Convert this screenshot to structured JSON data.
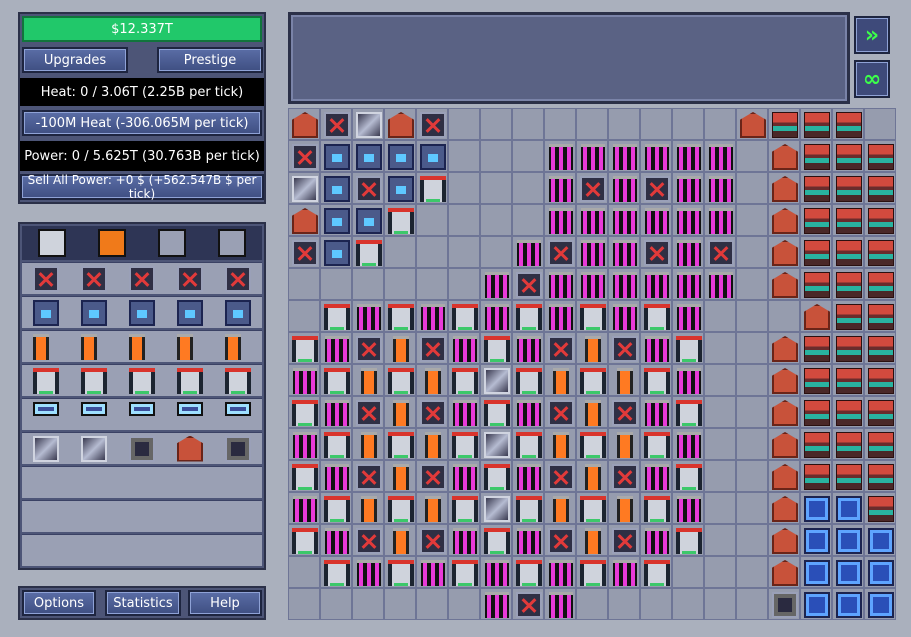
{
  "money": "$12.337T",
  "buttons": {
    "upgrades": "Upgrades",
    "prestige": "Prestige",
    "vent_heat": "-100M Heat (-306.065M per tick)",
    "sell_power": "Sell All Power: +0 $ (+562.547B $ per tick)",
    "options": "Options",
    "statistics": "Statistics",
    "help": "Help"
  },
  "heat_status": "Heat: 0 / 3.06T (2.25B per tick)",
  "power_status": "Power: 0 / 5.625T (30.763B per tick)",
  "side_icons": [
    "fast-forward-icon",
    "infinity-icon"
  ],
  "palette": {
    "tabs": [
      "cells-tab-icon",
      "heat-tab-icon",
      "locked-tab-icon",
      "locked-tab-icon"
    ],
    "rows": [
      [
        "vent",
        "vent",
        "vent",
        "vent",
        "vent"
      ],
      [
        "mech",
        "mech",
        "mech",
        "mech",
        "mech"
      ],
      [
        "rod",
        "rod",
        "rod",
        "rod",
        "rod"
      ],
      [
        "cool",
        "cool",
        "cool",
        "cool",
        "cool"
      ],
      [
        "cap",
        "cap",
        "cap",
        "cap",
        "cap"
      ],
      [
        "plate",
        "plate",
        "reflect",
        "house",
        "reflect"
      ],
      [],
      [],
      []
    ]
  },
  "grid": {
    "cols": 19,
    "rows": [
      "HVPHV.........HGGG",
      "VMMMM...pppppp.HGGG",
      "PMVMC...pVpVpp.HGGG",
      "HMMC....pppppp.HGGG",
      "VMC....pVppVpV.HGGG",
      "......pVpppppp.HGGG",
      ".CpCpCpCpCpCp...HGGG",
      "CpVrVpCpVrVpC..HGGG",
      "pCrCrCPCrCrCp..HGGG",
      "CpVrVpCpVrVpC..HGGG",
      "pCrCrCPCrCrCp..HGGG",
      "CpVrVpCpVrVpC..HGGG",
      "pCrCrCPCrCrCp..HBBG",
      "CpVrVpCpVrVpC..HBBB",
      ".CpCpCpCpCpC...HBBB",
      "......pVp......RBBB"
    ]
  }
}
